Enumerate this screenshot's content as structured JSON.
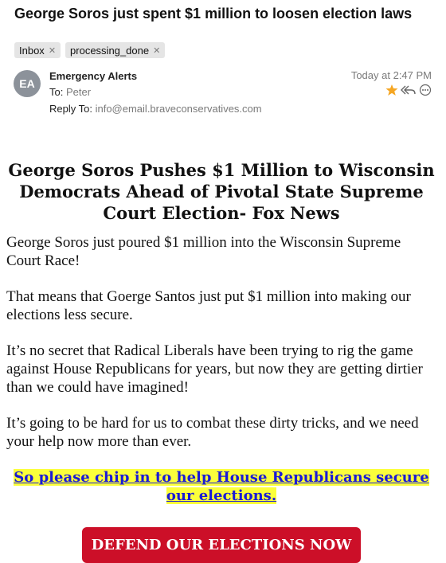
{
  "email": {
    "subject": "George Soros just spent $1 million to loosen election laws",
    "tags": [
      {
        "label": "Inbox"
      },
      {
        "label": "processing_done"
      }
    ],
    "sender": {
      "initials": "EA",
      "name": "Emergency Alerts"
    },
    "to_label": "To:",
    "to": "Peter",
    "reply_to_label": "Reply To:",
    "reply_to": "info@email.braveconservatives.com",
    "date": "Today at 2:47 PM",
    "colors": {
      "star": "#f5a623",
      "avatar": "#8c929a"
    }
  },
  "content": {
    "headline": "George Soros Pushes $1 Million to Wisconsin Democrats Ahead of Pivotal State Supreme Court Election- Fox News",
    "paragraphs": [
      "George Soros just poured $1 million into the Wisconsin Supreme Court Race!",
      "That means that Goerge Santos just put $1 million into making our elections less secure.",
      "It’s no secret that Radical Liberals have been trying to rig the game against House Republicans for years, but now they are getting dirtier than we could have imagined!",
      "It’s going to be hard for us to combat these dirty tricks, and we need your help now more than ever."
    ],
    "cta_link": "So please chip in to help House Republicans secure our elections.",
    "donate_button": "DEFEND OUR ELECTIONS NOW",
    "colors": {
      "link": "#1a1ad6",
      "highlight": "#fbff3b",
      "button": "#cc0f28"
    }
  }
}
